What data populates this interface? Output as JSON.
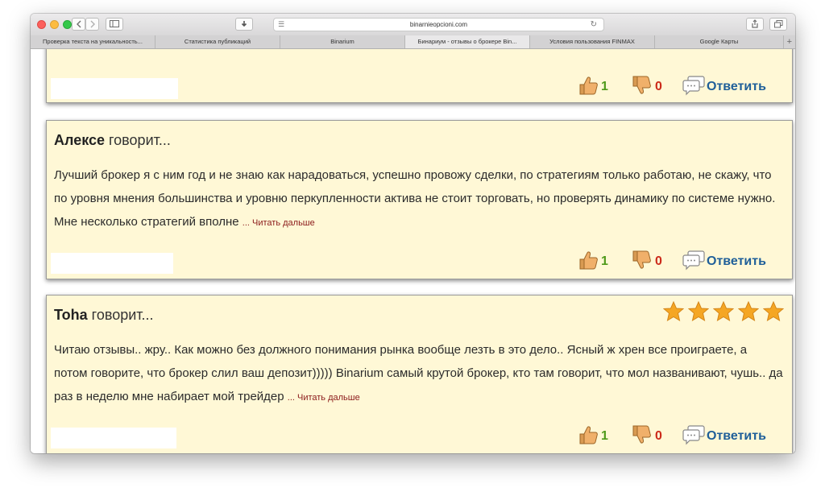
{
  "browser": {
    "address": "binarnieopcioni.com",
    "tabs": [
      {
        "label": "Проверка текста на уникальность...",
        "active": false
      },
      {
        "label": "Статистика публикаций",
        "active": false
      },
      {
        "label": "Binarium",
        "active": false
      },
      {
        "label": "Бинариум - отзывы о брокере Bin...",
        "active": true
      },
      {
        "label": "Условия пользования FINMAX",
        "active": false
      },
      {
        "label": "Google Карты",
        "active": false
      }
    ]
  },
  "comments": [
    {
      "likes": "1",
      "dislikes": "0",
      "reply": "Ответить"
    },
    {
      "author": "Алексе",
      "says": " говорит...",
      "text": "Лучший брокер я с ним год и не знаю как нарадоваться, успешно провожу сделки, по стратегиям только работаю, не скажу, что по уровня мнения большинства и уровню перкупленности актива не стоит торговать, но проверять динамику по системе нужно. Мне несколько стратегий вполне ",
      "read_more": "... Читать дальше",
      "likes": "1",
      "dislikes": "0",
      "reply": "Ответить"
    },
    {
      "author": "Toha",
      "says": " говорит...",
      "rating": 5,
      "text": "Читаю отзывы.. жру.. Как можно без должного понимания рынка вообще лезть в это дело.. Ясный ж хрен все проиграете, а потом говорите, что брокер слил ваш депозит))))) Binarium самый крутой брокер, кто там говорит, что мол названивают, чушь.. да раз в неделю мне набирает мой трейдер ",
      "read_more": "... Читать дальше",
      "likes": "1",
      "dislikes": "0",
      "reply": "Ответить"
    }
  ],
  "colors": {
    "comment_bg": "#fff8d6",
    "like": "#4f9a1a",
    "dislike": "#cc2a1a",
    "reply": "#1f5f99",
    "read_more": "#8b1a1a",
    "star": "#f5a623"
  }
}
